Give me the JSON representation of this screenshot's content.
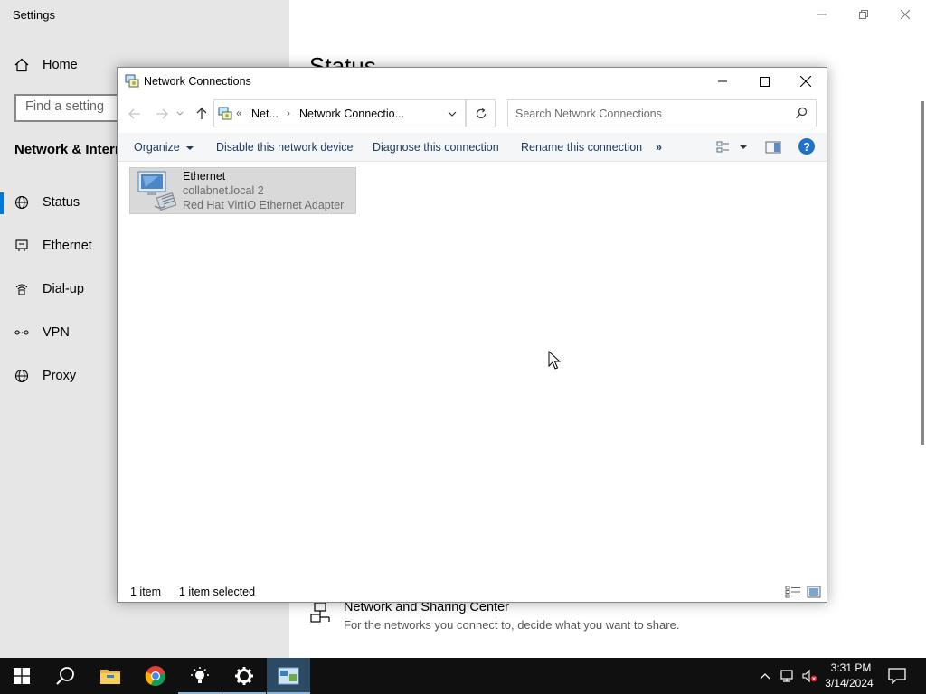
{
  "settings": {
    "title": "Settings",
    "home_label": "Home",
    "search_placeholder": "Find a setting",
    "section_title": "Network & Interne",
    "nav": [
      {
        "label": "Status",
        "icon": "globe-icon"
      },
      {
        "label": "Ethernet",
        "icon": "ethernet-icon"
      },
      {
        "label": "Dial-up",
        "icon": "dialup-icon"
      },
      {
        "label": "VPN",
        "icon": "vpn-icon"
      },
      {
        "label": "Proxy",
        "icon": "globe-icon"
      }
    ],
    "main_title": "Status",
    "sharing_center": {
      "title": "Network and Sharing Center",
      "description": "For the networks you connect to, decide what you want to share."
    },
    "accent_color": "#0078d7"
  },
  "network_window": {
    "title": "Network Connections",
    "address": {
      "prefix": "«",
      "segment1": "Net...",
      "segment2": "Network Connectio..."
    },
    "search_placeholder": "Search Network Connections",
    "commands": {
      "organize": "Organize",
      "disable": "Disable this network device",
      "diagnose": "Diagnose this connection",
      "rename": "Rename this connection",
      "more": "»"
    },
    "help_label": "?",
    "item": {
      "name": "Ethernet",
      "network": "collabnet.local 2",
      "adapter": "Red Hat VirtIO Ethernet Adapter"
    },
    "statusbar": {
      "count": "1 item",
      "selected": "1 item selected"
    }
  },
  "taskbar": {
    "apps": [
      "windows-start-icon",
      "search-icon",
      "file-explorer-icon",
      "chrome-icon",
      "tips-icon",
      "settings-icon",
      "network-connections-icon"
    ],
    "time": "3:31 PM",
    "date": "3/14/2024"
  }
}
